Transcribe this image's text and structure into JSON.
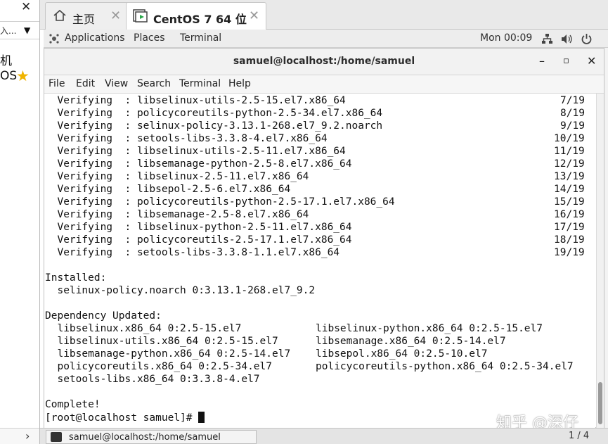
{
  "sidebar": {
    "close_glyph": "✕",
    "combo_text": "入...",
    "line1": "机",
    "line2": "OS",
    "chevron": "›"
  },
  "vm_tabs": {
    "home_label": "主页",
    "centos_label": "CentOS 7 64 位",
    "close_glyph": "✕"
  },
  "gnome_bar": {
    "applications": "Applications",
    "places": "Places",
    "terminal": "Terminal",
    "clock": "Mon 00:09"
  },
  "window": {
    "title": "samuel@localhost:/home/samuel",
    "minimize": "–",
    "maximize": "▫",
    "close": "✕"
  },
  "menubar": [
    "File",
    "Edit",
    "View",
    "Search",
    "Terminal",
    "Help"
  ],
  "terminal": {
    "verify_lines": [
      {
        "text": "  Verifying  : libselinux-utils-2.5-15.el7.x86_64",
        "count": "7/19"
      },
      {
        "text": "  Verifying  : policycoreutils-python-2.5-34.el7.x86_64",
        "count": "8/19"
      },
      {
        "text": "  Verifying  : selinux-policy-3.13.1-268.el7_9.2.noarch",
        "count": "9/19"
      },
      {
        "text": "  Verifying  : setools-libs-3.3.8-4.el7.x86_64",
        "count": "10/19"
      },
      {
        "text": "  Verifying  : libselinux-utils-2.5-11.el7.x86_64",
        "count": "11/19"
      },
      {
        "text": "  Verifying  : libsemanage-python-2.5-8.el7.x86_64",
        "count": "12/19"
      },
      {
        "text": "  Verifying  : libselinux-2.5-11.el7.x86_64",
        "count": "13/19"
      },
      {
        "text": "  Verifying  : libsepol-2.5-6.el7.x86_64",
        "count": "14/19"
      },
      {
        "text": "  Verifying  : policycoreutils-python-2.5-17.1.el7.x86_64",
        "count": "15/19"
      },
      {
        "text": "  Verifying  : libsemanage-2.5-8.el7.x86_64",
        "count": "16/19"
      },
      {
        "text": "  Verifying  : libselinux-python-2.5-11.el7.x86_64",
        "count": "17/19"
      },
      {
        "text": "  Verifying  : policycoreutils-2.5-17.1.el7.x86_64",
        "count": "18/19"
      },
      {
        "text": "  Verifying  : setools-libs-3.3.8-1.1.el7.x86_64",
        "count": "19/19"
      }
    ],
    "installed_header": "Installed:",
    "installed_pkg": "  selinux-policy.noarch 0:3.13.1-268.el7_9.2",
    "dep_header": "Dependency Updated:",
    "dep_rows": [
      {
        "left": "  libselinux.x86_64 0:2.5-15.el7",
        "right": "libselinux-python.x86_64 0:2.5-15.el7"
      },
      {
        "left": "  libselinux-utils.x86_64 0:2.5-15.el7",
        "right": "libsemanage.x86_64 0:2.5-14.el7"
      },
      {
        "left": "  libsemanage-python.x86_64 0:2.5-14.el7",
        "right": "libsepol.x86_64 0:2.5-10.el7"
      },
      {
        "left": "  policycoreutils.x86_64 0:2.5-34.el7",
        "right": "policycoreutils-python.x86_64 0:2.5-34.el7"
      },
      {
        "left": "  setools-libs.x86_64 0:3.3.8-4.el7",
        "right": ""
      }
    ],
    "complete": "Complete!",
    "prompt": "[root@localhost samuel]# "
  },
  "watermark": "知乎 @深仔",
  "taskbar": {
    "item_label": "samuel@localhost:/home/samuel",
    "pager": "1 / 4"
  }
}
